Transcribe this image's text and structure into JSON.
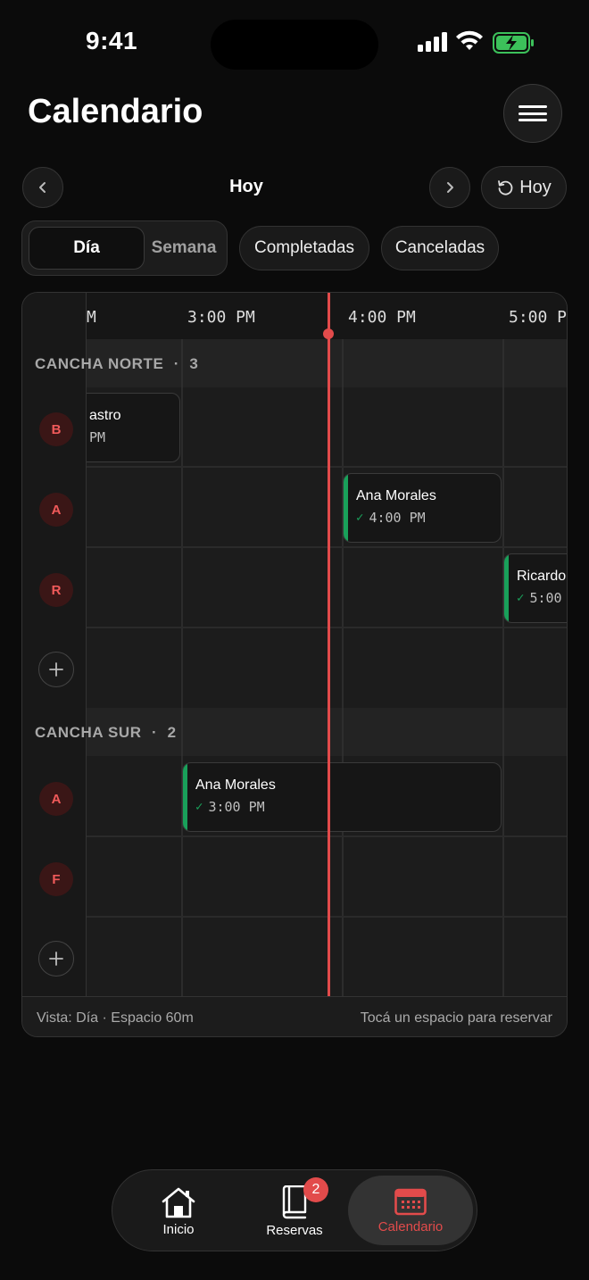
{
  "status_bar": {
    "time": "9:41"
  },
  "header": {
    "title": "Calendario"
  },
  "date_nav": {
    "date_label": "Hoy",
    "today_label": "Hoy"
  },
  "filters": {
    "views": [
      "Día",
      "Semana"
    ],
    "active_view": "Día",
    "chips": [
      "Completadas",
      "Canceladas"
    ]
  },
  "timeline": {
    "time_labels": [
      "M",
      "3:00 PM",
      "4:00 PM",
      "5:00 P"
    ]
  },
  "groups": [
    {
      "name": "CANCHA NORTE",
      "separator": "·",
      "count": "3",
      "avatars": [
        "B",
        "A",
        "R"
      ],
      "events": [
        {
          "name": "astro",
          "time": "PM",
          "checked": false
        },
        {
          "name": "Ana Morales",
          "time": "4:00 PM",
          "checked": true
        },
        {
          "name": "Ricardo",
          "time": "5:00",
          "checked": true
        }
      ]
    },
    {
      "name": "CANCHA SUR",
      "separator": "·",
      "count": "2",
      "avatars": [
        "A",
        "F"
      ],
      "events": [
        {
          "name": "Ana Morales",
          "time": "3:00 PM",
          "checked": true
        }
      ]
    }
  ],
  "footer": {
    "left": "Vista: Día · Espacio 60m",
    "right": "Tocá un espacio para reservar"
  },
  "bottom_nav": {
    "items": [
      {
        "label": "Inicio",
        "icon": "home-icon"
      },
      {
        "label": "Reservas",
        "icon": "book-icon",
        "badge": "2"
      },
      {
        "label": "Calendario",
        "icon": "calendar-icon",
        "active": true
      }
    ]
  },
  "colors": {
    "accent": "#e24b4b",
    "success": "#19a05a",
    "background": "#0b0b0b"
  }
}
